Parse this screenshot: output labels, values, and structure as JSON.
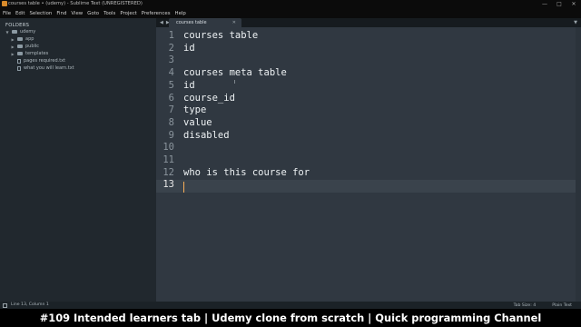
{
  "window": {
    "title": "courses table • (udemy) - Sublime Text (UNREGISTERED)"
  },
  "menu": [
    "File",
    "Edit",
    "Selection",
    "Find",
    "View",
    "Goto",
    "Tools",
    "Project",
    "Preferences",
    "Help"
  ],
  "sidebar": {
    "header": "FOLDERS",
    "root": "udemy",
    "items": [
      {
        "label": "app",
        "type": "folder"
      },
      {
        "label": "public",
        "type": "folder"
      },
      {
        "label": "templates",
        "type": "folder"
      },
      {
        "label": "pages required.txt",
        "type": "file"
      },
      {
        "label": "what you will learn.txt",
        "type": "file"
      }
    ]
  },
  "tabs": [
    {
      "label": "courses table",
      "active": true
    }
  ],
  "editor": {
    "current_line": 13,
    "lines": [
      "courses table",
      "id",
      "",
      "courses meta table",
      "id",
      "course_id",
      "type",
      "value",
      "disabled",
      "",
      "",
      "who is this course for",
      ""
    ],
    "line_numbers": [
      "1",
      "2",
      "3",
      "4",
      "5",
      "6",
      "7",
      "8",
      "9",
      "10",
      "11",
      "12",
      "13"
    ]
  },
  "status": {
    "position": "Line 13, Column 1",
    "tab_size": "Tab Size: 4",
    "syntax": "Plain Text"
  },
  "caption": "#109 Intended learners tab | Udemy clone from scratch | Quick programming Channel",
  "colors": {
    "editor_bg": "#303841",
    "sidebar_bg": "#21282e",
    "caret": "#f9ae58",
    "text": "#eef2f4"
  }
}
